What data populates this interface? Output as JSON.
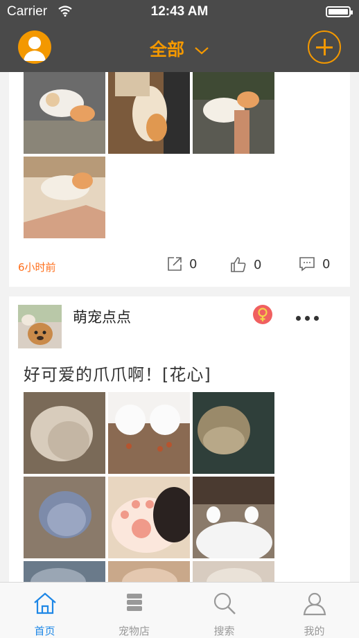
{
  "status_bar": {
    "carrier": "Carrier",
    "time": "12:43 AM",
    "battery_level": 1.0
  },
  "navbar": {
    "title": "全部"
  },
  "posts": [
    {
      "time": "6小时前",
      "share_count": "0",
      "like_count": "0",
      "comment_count": "0"
    },
    {
      "username": "萌宠点点",
      "text": "好可爱的爪爪啊！[花心]"
    }
  ],
  "tabbar": {
    "tabs": [
      {
        "label": "首页"
      },
      {
        "label": "宠物店"
      },
      {
        "label": "搜索"
      },
      {
        "label": "我的"
      }
    ]
  },
  "colors": {
    "accent": "#f39800",
    "nav_bg": "#4a4a4a",
    "tab_active": "#1e87e6",
    "time_label": "#ff6e1a"
  },
  "icons": [
    "user-avatar-icon",
    "chevron-down-icon",
    "plus-icon",
    "share-icon",
    "thumbs-up-icon",
    "comment-icon",
    "female-icon",
    "more-icon",
    "home-icon",
    "store-icon",
    "search-icon",
    "profile-icon"
  ]
}
